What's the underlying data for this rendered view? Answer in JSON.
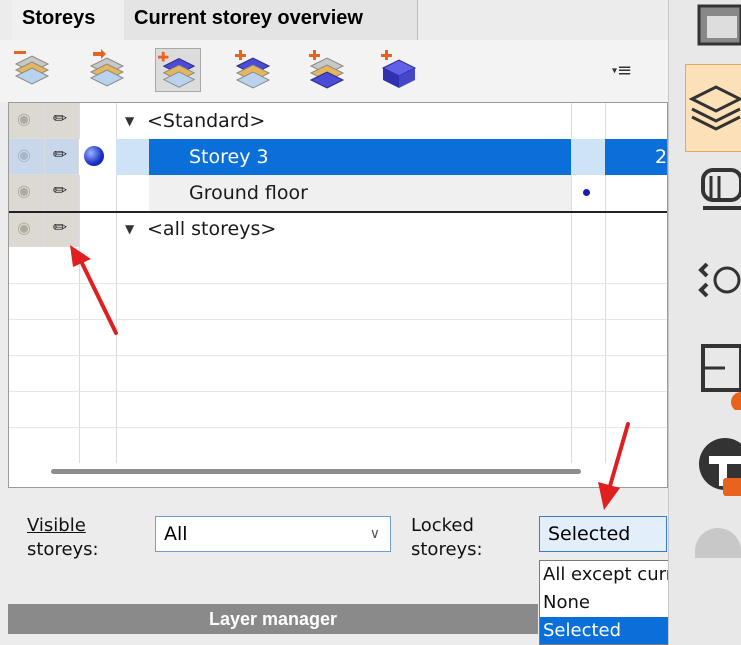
{
  "tabs": [
    {
      "label": "Storeys",
      "active": true
    },
    {
      "label": "Current storey overview",
      "active": false
    }
  ],
  "toolbar": {
    "buttons": [
      "remove-storey-icon",
      "insert-storey-above-icon",
      "storey-stack-icon",
      "add-storey-below-icon",
      "add-storey-icon",
      "add-block-storey-icon"
    ],
    "menu_icon": "≡"
  },
  "tree": {
    "groups": [
      {
        "label": "<Standard>",
        "storeys": [
          {
            "name": "Storey 3",
            "selected": true,
            "current": true,
            "trailing": "2"
          },
          {
            "name": "Ground floor",
            "selected": false,
            "current": false,
            "trailing": ""
          }
        ]
      },
      {
        "label": "<all storeys>",
        "storeys": []
      }
    ]
  },
  "filters": {
    "visible_label_line1": "Visible",
    "visible_label_line2": "storeys:",
    "visible_value": "All",
    "locked_label_line1": "Locked",
    "locked_label_line2": "storeys:",
    "locked_value": "Selected",
    "locked_options": [
      "All except current",
      "None",
      "Selected"
    ]
  },
  "layer_manager": {
    "label": "Layer manager"
  },
  "colors": {
    "selection": "#0a6fd8",
    "annotation_arrow": "#e02020"
  }
}
